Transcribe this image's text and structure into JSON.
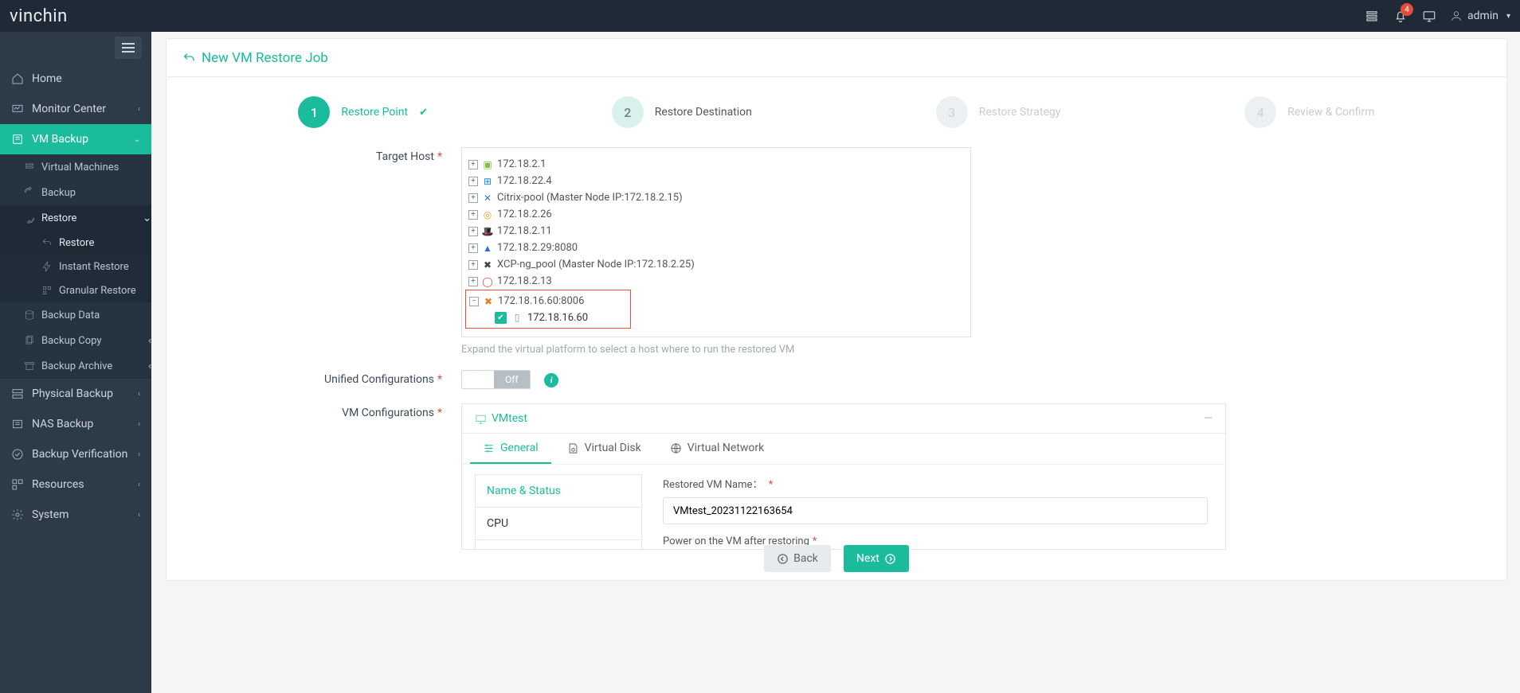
{
  "brand": "vinchin",
  "header": {
    "notification_count": "4",
    "username": "admin"
  },
  "sidebar": {
    "home": "Home",
    "monitor_center": "Monitor Center",
    "vm_backup": "VM Backup",
    "sub": {
      "virtual_machines": "Virtual Machines",
      "backup": "Backup",
      "restore": "Restore",
      "restore_sub": {
        "restore": "Restore",
        "instant_restore": "Instant Restore",
        "granular_restore": "Granular Restore"
      },
      "backup_data": "Backup Data",
      "backup_copy": "Backup Copy",
      "backup_archive": "Backup Archive"
    },
    "physical_backup": "Physical Backup",
    "nas_backup": "NAS Backup",
    "backup_verification": "Backup Verification",
    "resources": "Resources",
    "system": "System"
  },
  "page": {
    "title": "New VM Restore Job",
    "steps": {
      "s1": {
        "num": "1",
        "label": "Restore Point"
      },
      "s2": {
        "num": "2",
        "label": "Restore Destination"
      },
      "s3": {
        "num": "3",
        "label": "Restore Strategy"
      },
      "s4": {
        "num": "4",
        "label": "Review & Confirm"
      }
    },
    "labels": {
      "target_host": "Target Host",
      "unified_config": "Unified Configurations",
      "vm_config": "VM Configurations"
    },
    "toggle_off": "Off",
    "tree": {
      "n0": "172.18.2.1",
      "n1": "172.18.22.4",
      "n2": "Citrix-pool (Master Node IP:172.18.2.15)",
      "n3": "172.18.2.26",
      "n4": "172.18.2.11",
      "n5": "172.18.2.29:8080",
      "n6": "XCP-ng_pool (Master Node IP:172.18.2.25)",
      "n7": "172.18.2.13",
      "n8": "172.18.16.60:8006",
      "n8_child": "172.18.16.60",
      "help": "Expand the virtual platform to select a host where to run the restored VM"
    },
    "vmconf": {
      "vm_name": "VMtest",
      "tabs": {
        "general": "General",
        "vdisk": "Virtual Disk",
        "vnet": "Virtual Network"
      },
      "side": {
        "name_status": "Name & Status",
        "cpu": "CPU"
      },
      "form": {
        "restored_name_label": "Restored VM Name：",
        "restored_name_value": "VMtest_20231122163654",
        "power_on_label": "Power on the VM after restoring"
      }
    },
    "buttons": {
      "back": "Back",
      "next": "Next"
    }
  }
}
